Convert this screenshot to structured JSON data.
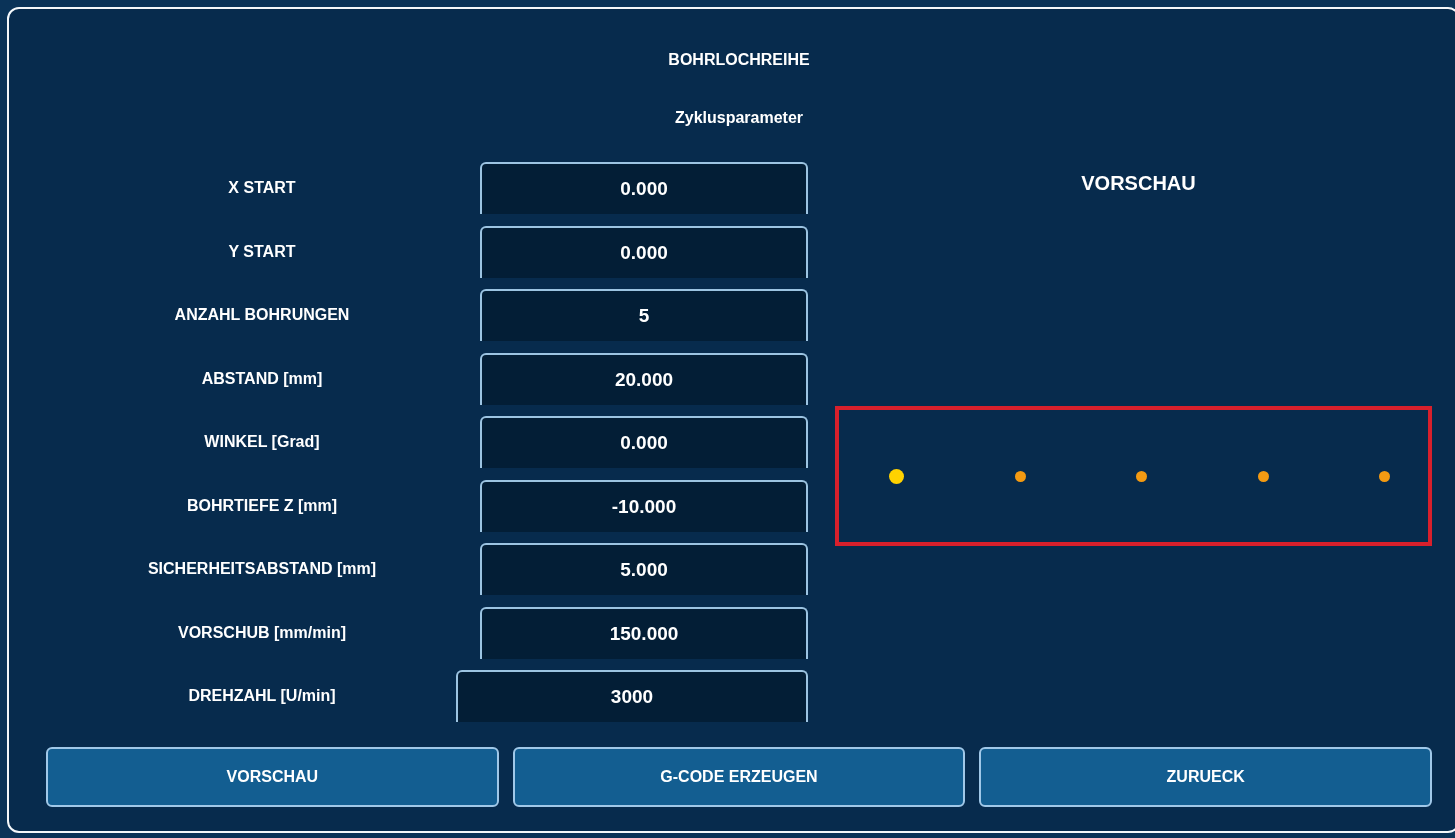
{
  "dialog": {
    "title": "BOHRLOCHREIHE",
    "subtitle": "Zyklusparameter"
  },
  "fields": [
    {
      "label": "X START",
      "value": "0.000"
    },
    {
      "label": "Y START",
      "value": "0.000"
    },
    {
      "label": "ANZAHL BOHRUNGEN",
      "value": "5"
    },
    {
      "label": "ABSTAND [mm]",
      "value": "20.000"
    },
    {
      "label": "WINKEL [Grad]",
      "value": "0.000"
    },
    {
      "label": "BOHRTIEFE Z [mm]",
      "value": "-10.000"
    },
    {
      "label": "SICHERHEITSABSTAND [mm]",
      "value": "5.000"
    },
    {
      "label": "VORSCHUB [mm/min]",
      "value": "150.000"
    },
    {
      "label": "DREHZAHL [U/min]",
      "value": "3000"
    }
  ],
  "preview": {
    "title": "VORSCHAU",
    "holes": [
      {
        "kind": "start",
        "color": "#ffd200"
      },
      {
        "kind": "hole",
        "color": "#f39a12"
      },
      {
        "kind": "hole",
        "color": "#f39a12"
      },
      {
        "kind": "hole",
        "color": "#f39a12"
      },
      {
        "kind": "hole",
        "color": "#f39a12"
      }
    ]
  },
  "buttons": [
    "VORSCHAU",
    "G-CODE ERZEUGEN",
    "ZURUECK"
  ]
}
